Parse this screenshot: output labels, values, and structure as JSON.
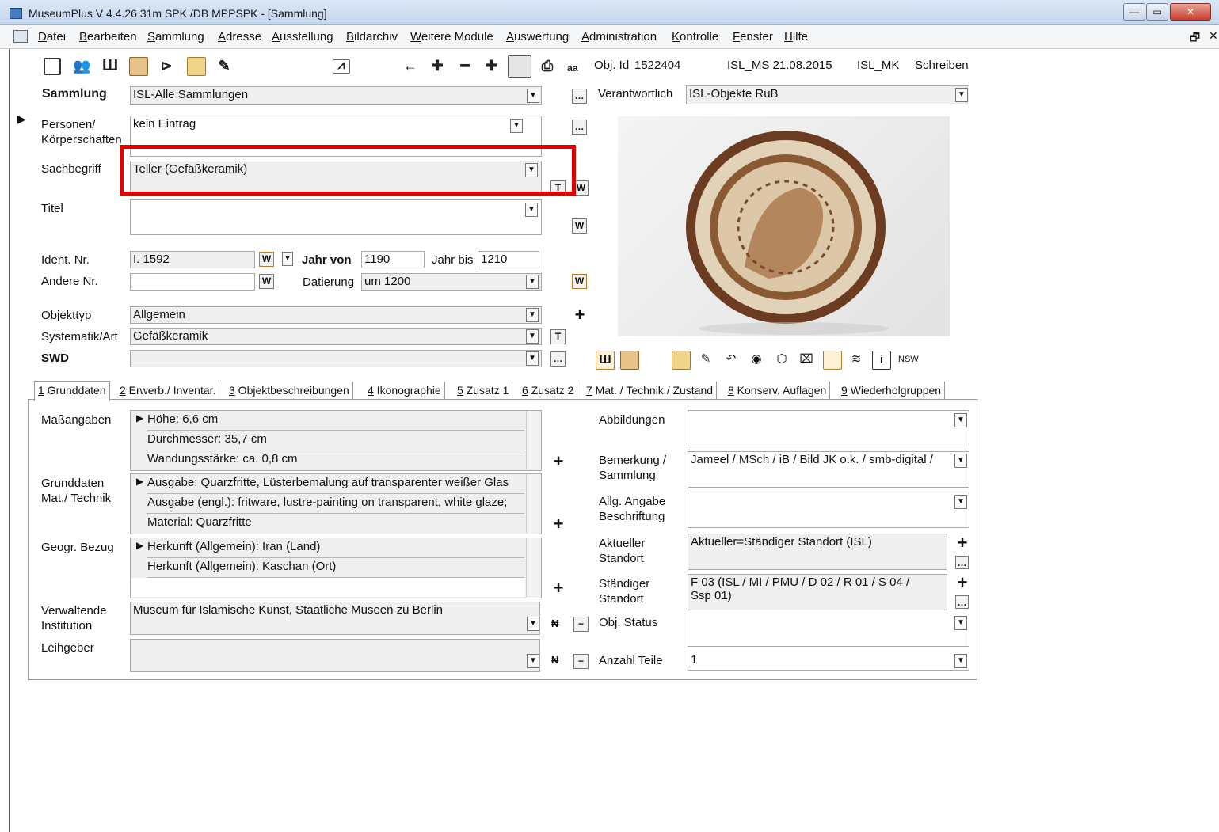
{
  "window": {
    "title": "MuseumPlus V 4.4.26 31m SPK /DB MPPSPK - [Sammlung]"
  },
  "menu": [
    "Datei",
    "Bearbeiten",
    "Sammlung",
    "Adresse",
    "Ausstellung",
    "Bildarchiv",
    "Weitere Module",
    "Auswertung",
    "Administration",
    "Kontrolle",
    "Fenster",
    "Hilfe"
  ],
  "toolbar": {
    "obj_id_label": "Obj. Id",
    "obj_id_value": "1522404",
    "isl_ms": "ISL_MS 21.08.2015",
    "isl_mk": "ISL_MK",
    "mode": "Schreiben"
  },
  "form": {
    "sammlung_label": "Sammlung",
    "sammlung_value": "ISL-Alle Sammlungen",
    "verantwortlich_label": "Verantwortlich",
    "verantwortlich_value": "ISL-Objekte RuB",
    "personen_label1": "Personen/",
    "personen_label2": "Körperschaften",
    "personen_value": "kein Eintrag",
    "sachbegriff_label": "Sachbegriff",
    "sachbegriff_value": "Teller (Gefäßkeramik)",
    "titel_label": "Titel",
    "ident_label": "Ident. Nr.",
    "ident_value": "I. 1592",
    "jahr_von_label": "Jahr von",
    "jahr_von_value": "1190",
    "jahr_bis_label": "Jahr bis",
    "jahr_bis_value": "1210",
    "andere_label": "Andere Nr.",
    "datierung_label": "Datierung",
    "datierung_value": "um 1200",
    "objekttyp_label": "Objekttyp",
    "objekttyp_value": "Allgemein",
    "systematik_label": "Systematik/Art",
    "systematik_value": "Gefäßkeramik",
    "swd_label": "SWD"
  },
  "tabs": [
    "1 Grunddaten",
    "2 Erwerb./ Inventar.",
    "3 Objektbeschreibungen",
    "4 Ikonographie",
    "5 Zusatz 1",
    "6 Zusatz 2",
    "7 Mat. / Technik / Zustand",
    "8 Konserv. Auflagen",
    "9 Wiederholgruppen"
  ],
  "grunddaten": {
    "massangaben_label": "Maßangaben",
    "massangaben": [
      "Höhe: 6,6 cm",
      "Durchmesser: 35,7 cm",
      "Wandungsstärke: ca. 0,8 cm"
    ],
    "mat_label1": "Grunddaten",
    "mat_label2": "Mat./ Technik",
    "mat": [
      "Ausgabe: Quarzfritte, Lüsterbemalung auf transparenter weißer Glas",
      "Ausgabe (engl.): fritware, lustre-painting on transparent, white glaze;",
      "Material: Quarzfritte"
    ],
    "geogr_label": "Geogr. Bezug",
    "geogr": [
      "Herkunft (Allgemein): Iran (Land)",
      "Herkunft (Allgemein): Kaschan (Ort)"
    ],
    "verwaltende_label1": "Verwaltende",
    "verwaltende_label2": "Institution",
    "verwaltende_value": "Museum für Islamische Kunst, Staatliche Museen zu Berlin",
    "leihgeber_label": "Leihgeber"
  },
  "right": {
    "abbildungen_label": "Abbildungen",
    "bemerkung_label1": "Bemerkung /",
    "bemerkung_label2": "Sammlung",
    "bemerkung_value": "Jameel / MSch / iB / Bild JK o.k. / smb-digital /",
    "allg_label1": "Allg. Angabe",
    "allg_label2": "Beschriftung",
    "aktueller_label1": "Aktueller",
    "aktueller_label2": "Standort",
    "aktueller_value": "Aktueller=Ständiger Standort (ISL)",
    "staendiger_label1": "Ständiger",
    "staendiger_label2": "Standort",
    "staendiger_value1": "F 03 (ISL / MI / PMU / D 02 / R 01 / S 04 /",
    "staendiger_value2": "Ssp 01)",
    "status_label": "Obj. Status",
    "anzahl_label": "Anzahl Teile",
    "anzahl_value": "1"
  }
}
